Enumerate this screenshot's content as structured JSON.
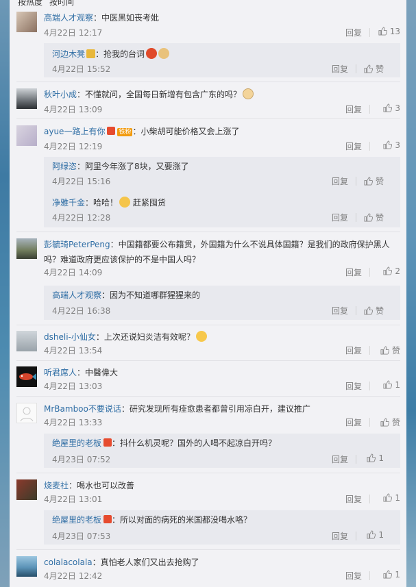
{
  "topbar": {
    "tab_hot": "按热度",
    "tab_time": "按时间"
  },
  "ui": {
    "reply_label": "回复",
    "like_label": "赞"
  },
  "colors": {
    "link": "#2e6da4",
    "meta": "#808080",
    "panel": "#f2f2f5",
    "sub_bg": "#e8e9ee"
  },
  "comments": [
    {
      "user": "高端人才观察",
      "text": "：中医黑如丧考妣",
      "date": "4月22日 12:17",
      "likes": "13"
    },
    {
      "user": "秋叶小成",
      "text": "：不懂就问，全国每日新增有包含广东的吗？",
      "date": "4月22日 13:09",
      "likes": "3"
    },
    {
      "user": "ayue一路上有你",
      "badge": "铁粉",
      "text": "：小柴胡可能价格又会上涨了",
      "date": "4月22日 12:19",
      "likes": "3"
    },
    {
      "user": "彭毓琦PeterPeng",
      "text": "：中国籍都要公布籍贯，外国籍为什么不说具体国籍？是我们的政府保护黑人吗？难道政府更应该保护的不是中国人吗？",
      "date": "4月22日 14:09",
      "likes": "2"
    },
    {
      "user": "dsheli-小仙女",
      "text": "：上次还说妇炎洁有效呢？",
      "date": "4月22日 13:54",
      "likes": "赞"
    },
    {
      "user": "听君席人",
      "text": "：中醫偉大",
      "date": "4月22日 13:03",
      "likes": "1"
    },
    {
      "user": "MrBamboo不要说话",
      "text": "：研究发现所有痊愈患者都曾引用凉白开，建议推广",
      "date": "4月22日 13:33",
      "likes": "赞"
    },
    {
      "user": "烧麦社",
      "text": "：喝水也可以改善",
      "date": "4月22日 13:01",
      "likes": "1"
    },
    {
      "user": "colalacolala",
      "text": "：真怕老人家们又出去抢购了",
      "date": "4月22日 12:42",
      "likes": "1"
    }
  ],
  "replies": [
    {
      "user": "河边木凳",
      "text": "：抢我的台词",
      "date": "4月22日 15:52",
      "likes": "赞"
    },
    {
      "user": "阿绿恣",
      "text": "：阿里今年涨了8块，又要涨了",
      "date": "4月22日 15:16",
      "likes": "赞"
    },
    {
      "user": "净雅千金",
      "text": "：哈哈！",
      "text2": "赶紧囤货",
      "date": "4月22日 12:28",
      "likes": "赞"
    },
    {
      "user": "高端人才观察",
      "text": "：因为不知道哪群猩猩来的",
      "date": "4月22日 16:38",
      "likes": "赞"
    },
    {
      "user": "绝屋里的老板",
      "text": "：抖什么机灵呢？国外的人喝不起凉白开吗？",
      "date": "4月23日 07:52",
      "likes": "1"
    },
    {
      "user": "绝屋里的老板",
      "text": "：所以对面的病死的米国都没喝水咯？",
      "date": "4月23日 07:53",
      "likes": "1"
    }
  ]
}
